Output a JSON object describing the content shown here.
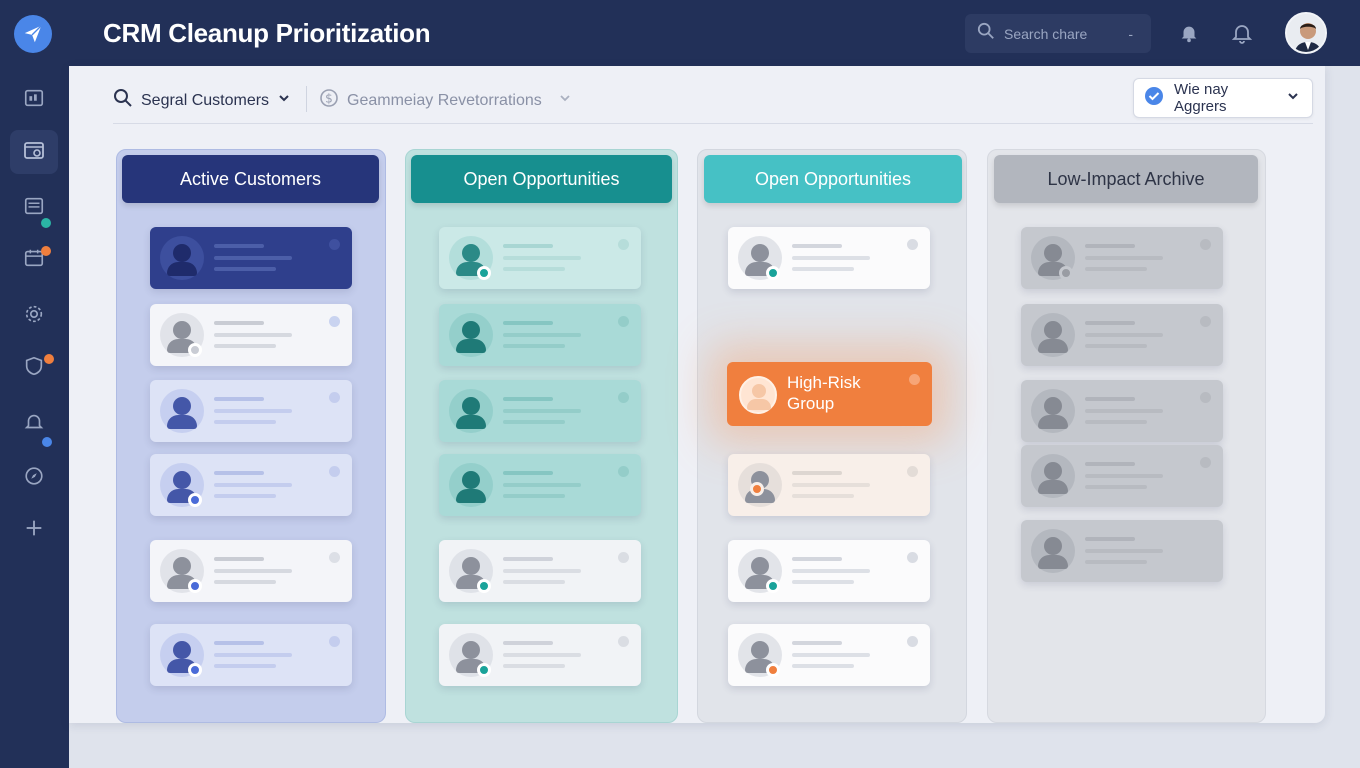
{
  "app": {
    "title": "CRM Cleanup Prioritization"
  },
  "search": {
    "placeholder": "Search chare",
    "shortcut": "-"
  },
  "toolbar": {
    "segment_filter": "Segral Customers",
    "second_filter": "Geammeiay Revetorrations",
    "view_selector": "Wie nay Aggrers"
  },
  "columns": [
    {
      "title": "Active Customers",
      "color": "#26357a"
    },
    {
      "title": "Open Opportunities",
      "color": "#178f8f"
    },
    {
      "title": "Open Opportunities",
      "color": "#46c1c5"
    },
    {
      "title": "Low-Impact Archive",
      "color": "#b2b6be"
    }
  ],
  "risk_card": {
    "label": "High-Risk Group"
  },
  "colors": {
    "header": "#223058",
    "accent_blue": "#4a86e8",
    "risk_orange": "#f07f3e"
  }
}
